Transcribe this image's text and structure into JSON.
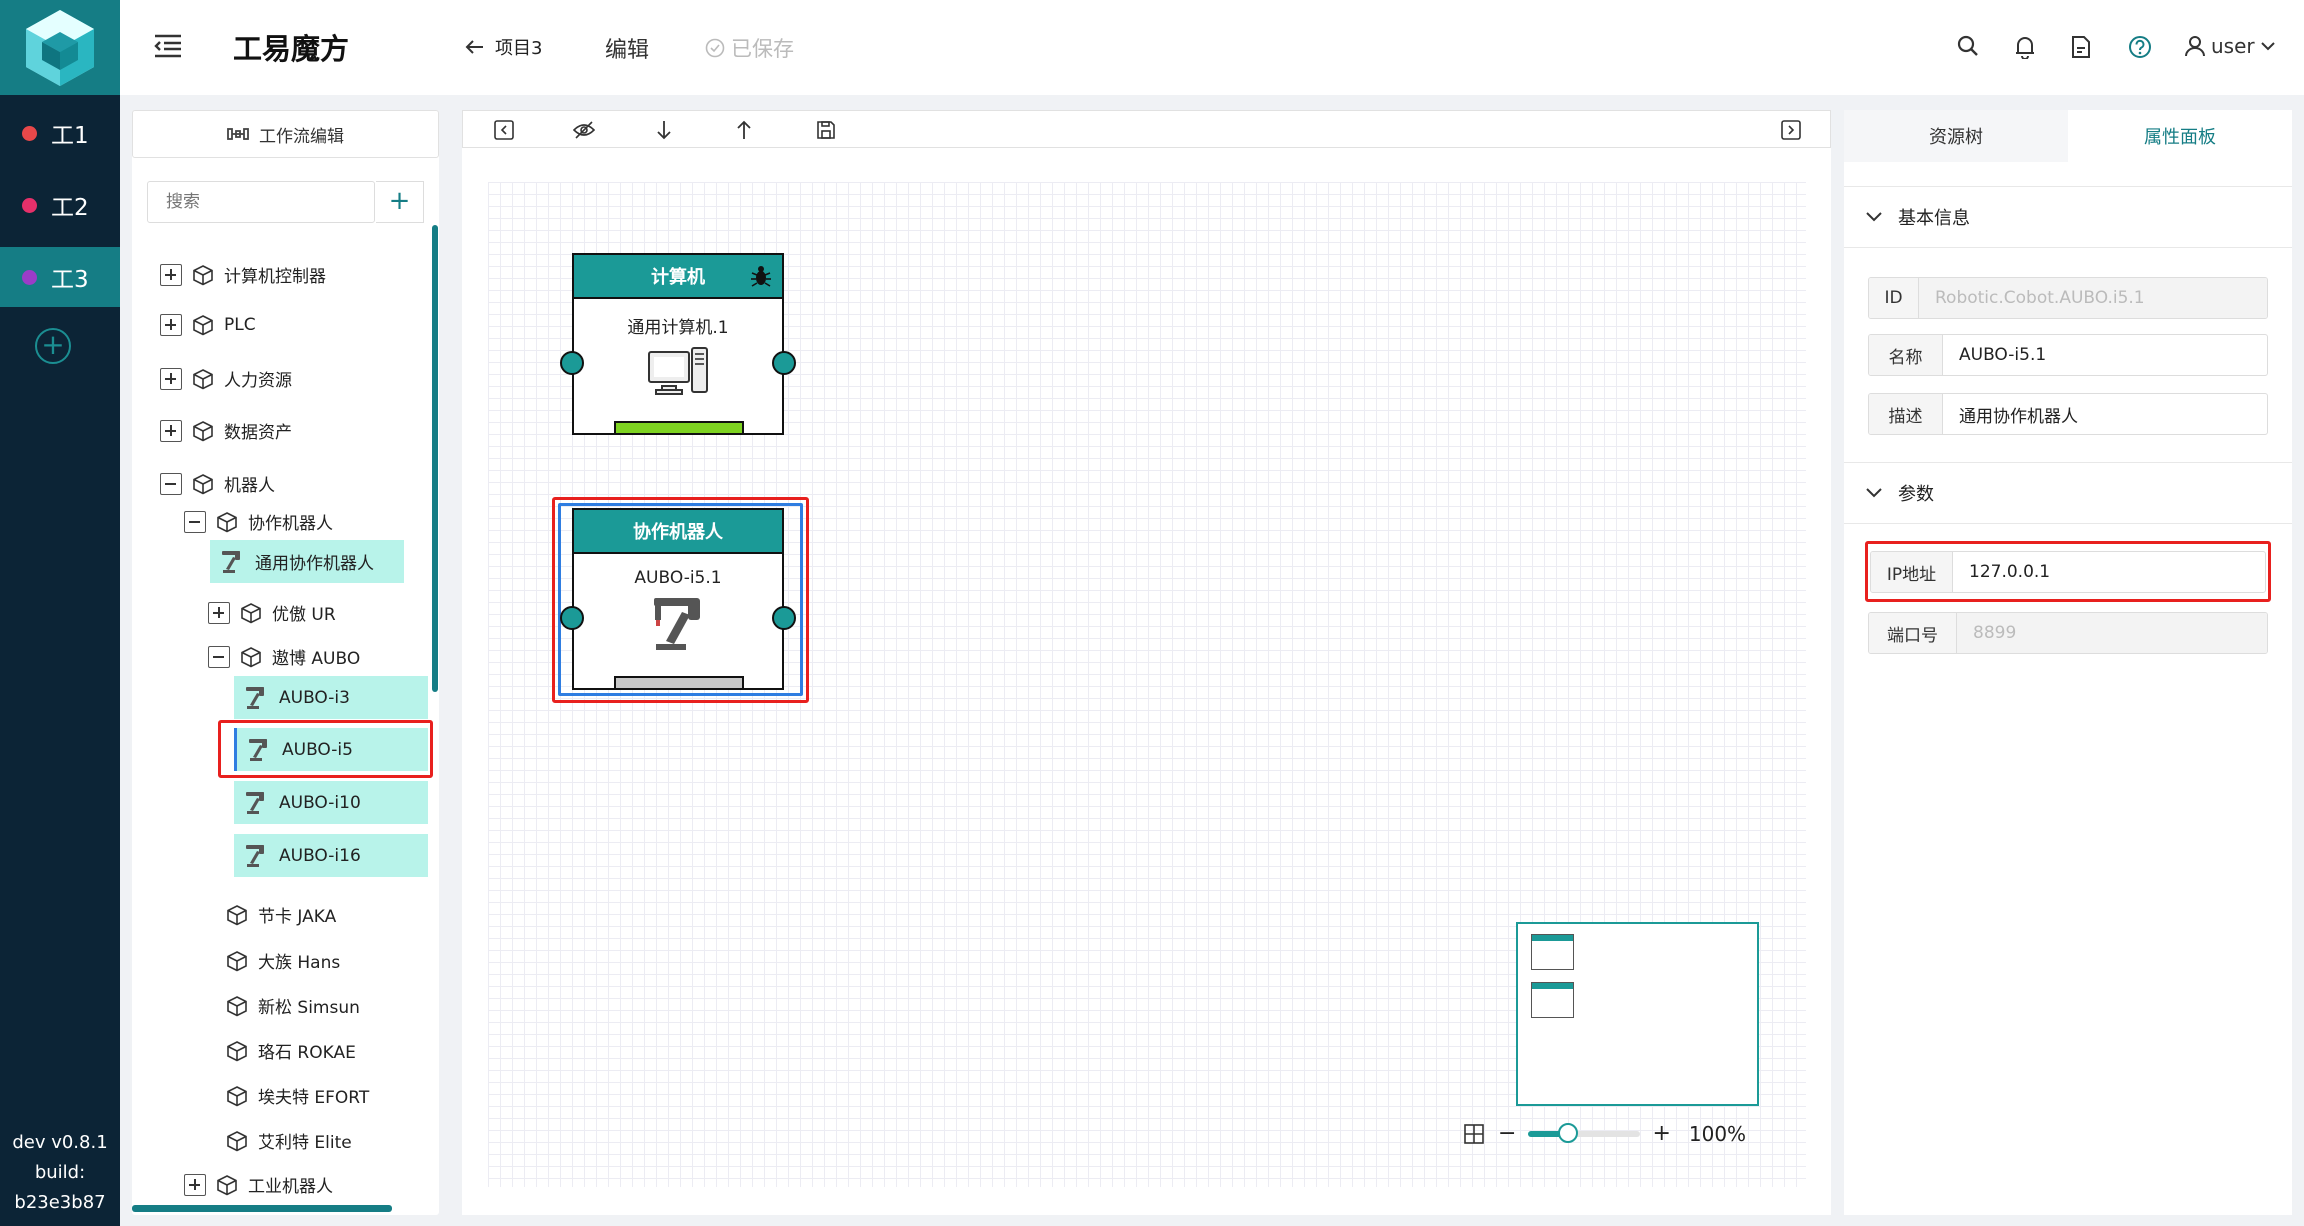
{
  "rail": {
    "workspaces": [
      {
        "label": "工1",
        "color": "#e8484a"
      },
      {
        "label": "工2",
        "color": "#e6306a"
      },
      {
        "label": "工3",
        "color": "#9b3cc8"
      }
    ],
    "version": "dev v0.8.1",
    "build_label": "build:",
    "build_hash": "b23e3b87"
  },
  "topbar": {
    "app_title": "工易魔方",
    "back_label": "项目3",
    "edit_label": "编辑",
    "saved_label": "已保存",
    "user_label": "user",
    "accent": "#157d85"
  },
  "tree": {
    "workflow_edit_label": "工作流编辑",
    "search_placeholder": "搜索",
    "items": [
      {
        "label": "计算机控制器"
      },
      {
        "label": "PLC"
      },
      {
        "label": "人力资源"
      },
      {
        "label": "数据资产"
      },
      {
        "label": "机器人"
      },
      {
        "label": "协作机器人"
      },
      {
        "label": "通用协作机器人"
      },
      {
        "label": "优傲 UR"
      },
      {
        "label": "遨博 AUBO"
      },
      {
        "label": "AUBO-i3"
      },
      {
        "label": "AUBO-i5"
      },
      {
        "label": "AUBO-i10"
      },
      {
        "label": "AUBO-i16"
      },
      {
        "label": "节卡 JAKA"
      },
      {
        "label": "大族 Hans"
      },
      {
        "label": "新松 Simsun"
      },
      {
        "label": "珞石 ROKAE"
      },
      {
        "label": "埃夫特 EFORT"
      },
      {
        "label": "艾利特 Elite"
      },
      {
        "label": "工业机器人"
      }
    ]
  },
  "canvas": {
    "nodes": [
      {
        "title": "计算机",
        "name": "通用计算机.1",
        "status_color": "#7ed321"
      },
      {
        "title": "协作机器人",
        "name": "AUBO-i5.1",
        "status_color": "#c8c8c8"
      }
    ],
    "zoom_label": "100%",
    "zoom_level": 0.35
  },
  "props": {
    "tabs": [
      "资源树",
      "属性面板"
    ],
    "active_tab": "属性面板",
    "basic_section": "基本信息",
    "params_section": "参数",
    "fields": {
      "id": {
        "label": "ID",
        "value": "Robotic.Cobot.AUBO.i5.1"
      },
      "name": {
        "label": "名称",
        "value": "AUBO-i5.1"
      },
      "desc": {
        "label": "描述",
        "value": "通用协作机器人"
      },
      "ip": {
        "label": "IP地址",
        "value": "127.0.0.1"
      },
      "port": {
        "label": "端口号",
        "value": "8899"
      }
    }
  }
}
